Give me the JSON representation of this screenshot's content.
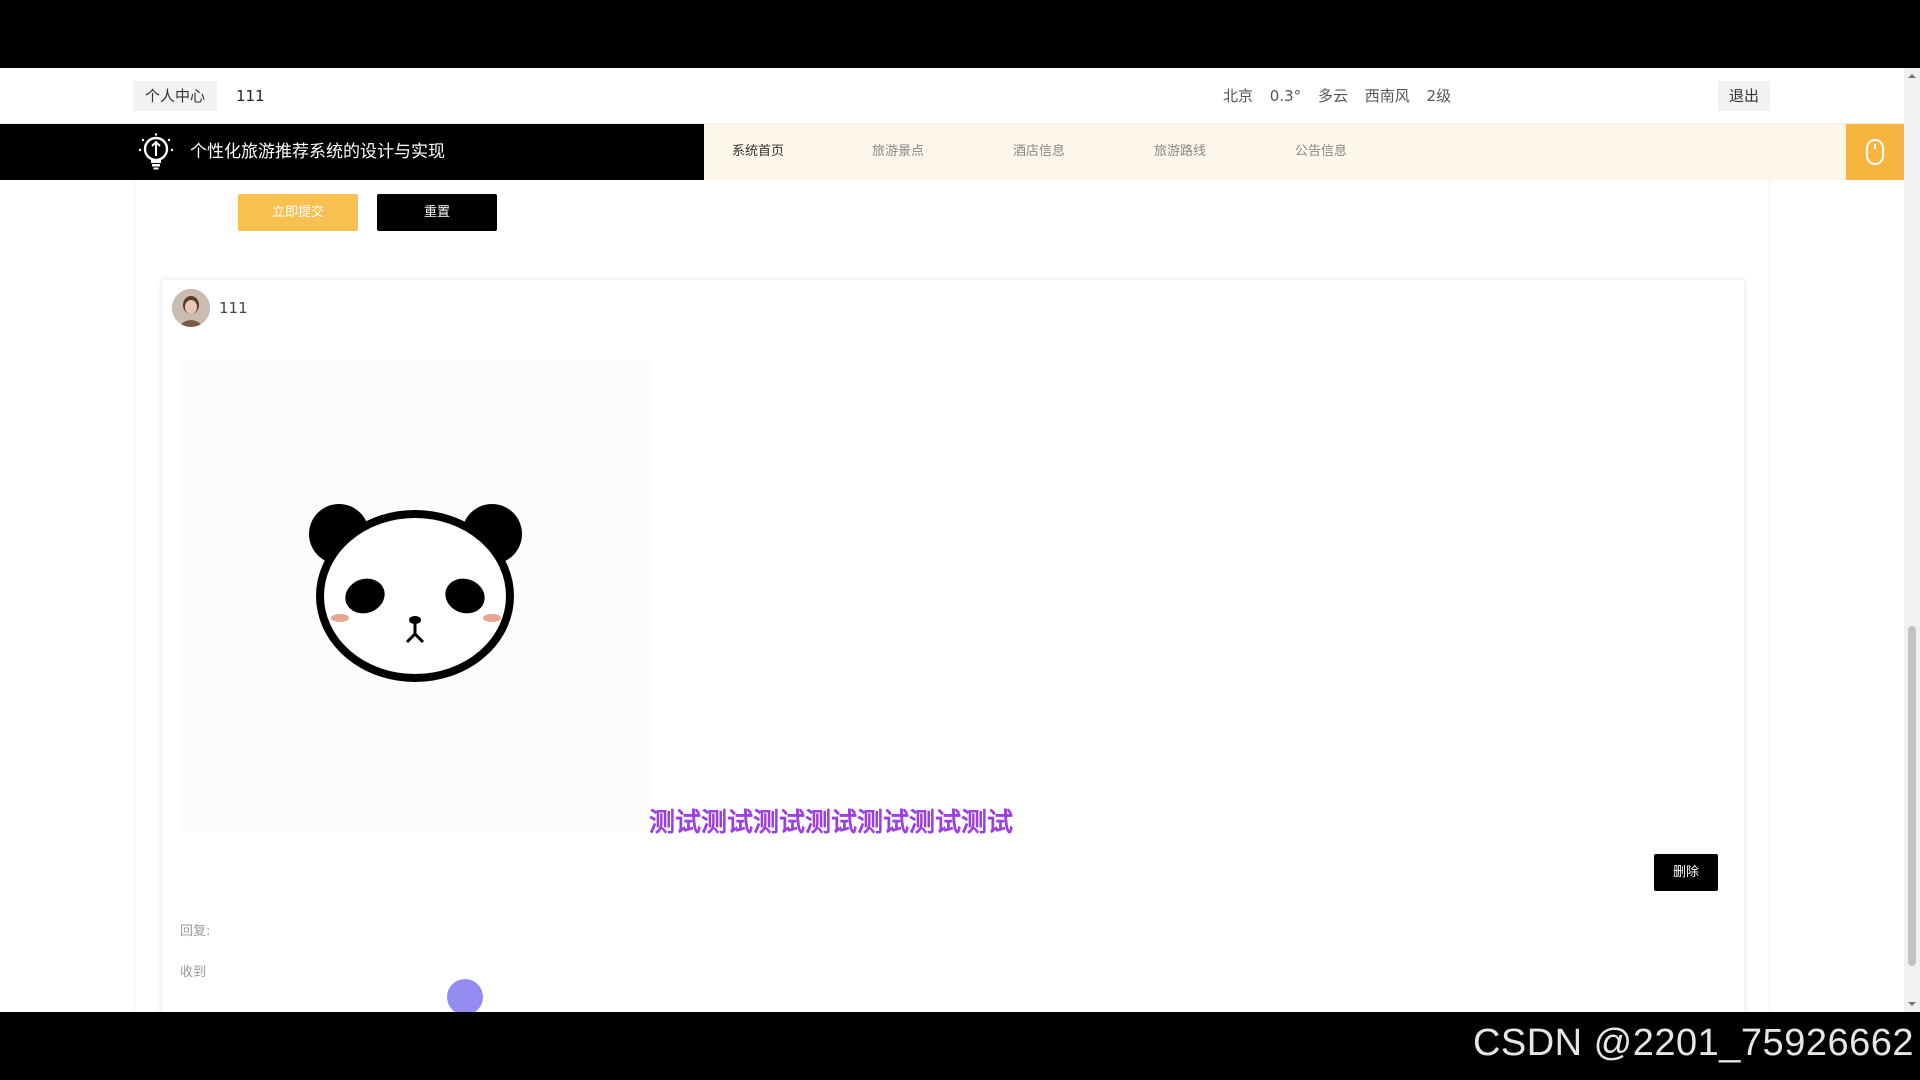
{
  "user_bar": {
    "personal_center": "个人中心",
    "username": "111",
    "weather": [
      "北京",
      "0.3°",
      "多云",
      "西南风",
      "2级"
    ],
    "logout": "退出"
  },
  "header": {
    "title": "个性化旅游推荐系统的设计与实现",
    "nav": [
      "系统首页",
      "旅游景点",
      "酒店信息",
      "旅游路线",
      "公告信息"
    ],
    "active_nav": "系统首页"
  },
  "form": {
    "submit_label": "立即提交",
    "reset_label": "重置"
  },
  "post": {
    "username": "111",
    "image_icon": "panda-image",
    "content": "测试测试测试测试测试测试测试",
    "delete_label": "删除",
    "reply_label": "回复:",
    "reply_text": "收到"
  },
  "watermark": "CSDN @2201_75926662",
  "colors": {
    "accent": "#f7c04f",
    "header_bg": "#fdf6ea",
    "post_text": "#9b3fe0"
  }
}
